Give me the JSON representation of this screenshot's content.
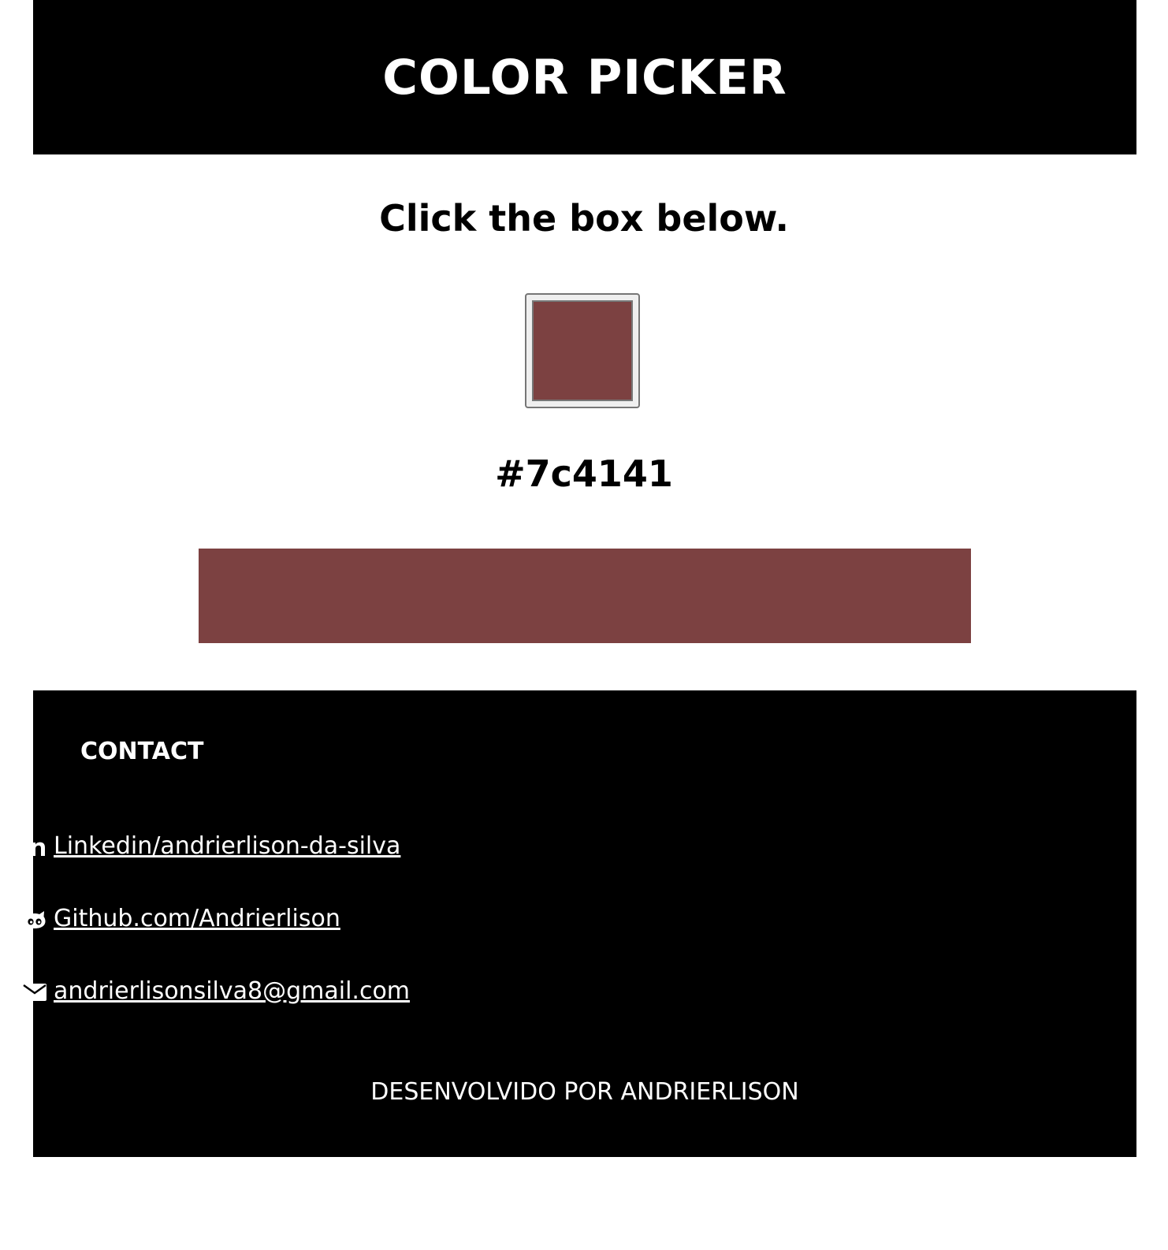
{
  "header": {
    "title": "COLOR PICKER"
  },
  "main": {
    "instruction": "Click the box below.",
    "selected_color": "#7c4141",
    "hex_label": "#7c4141"
  },
  "footer": {
    "contact_title": "CONTACT",
    "links": [
      {
        "icon": "linkedin-icon",
        "label": "Linkedin/andrierlison-da-silva"
      },
      {
        "icon": "github-icon",
        "label": "Github.com/Andrierlison"
      },
      {
        "icon": "envelope-icon",
        "label": "andrierlisonsilva8@gmail.com"
      }
    ],
    "credits": "DESENVOLVIDO POR ANDRIERLISON"
  },
  "colors": {
    "header_bg": "#000000",
    "footer_bg": "#000000",
    "text_on_dark": "#ffffff",
    "page_bg": "#ffffff"
  }
}
